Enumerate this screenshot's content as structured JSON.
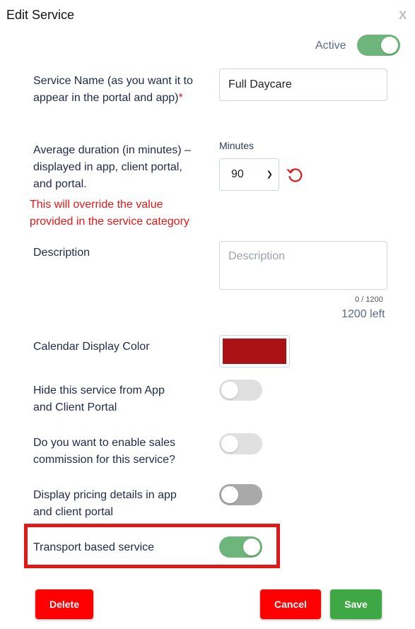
{
  "dialog": {
    "title": "Edit Service",
    "close_label": "X"
  },
  "active": {
    "label": "Active",
    "state": true
  },
  "service_name": {
    "label": "Service Name (as you want it to appear in the portal and app)",
    "required_mark": "*",
    "value": "Full Daycare"
  },
  "duration": {
    "label": "Average duration (in minutes) – displayed in app, client portal, and portal.",
    "unit_label": "Minutes",
    "selected": "90",
    "warning": "This will override the value provided in the service category",
    "reset_icon": "refresh-icon"
  },
  "description": {
    "label": "Description",
    "placeholder": "Description",
    "value": "",
    "counter": "0 / 1200",
    "remaining": "1200 left"
  },
  "calendar_color": {
    "label": "Calendar Display Color",
    "value": "#aa1215"
  },
  "hide_service": {
    "label": "Hide this service from App and Client Portal",
    "state": false
  },
  "sales_commission": {
    "label": "Do you want to enable sales commission for this service?",
    "state": false
  },
  "display_pricing": {
    "label": "Display pricing details in app and client portal",
    "state": false
  },
  "transport_based": {
    "label": "Transport based service",
    "state": true
  },
  "buttons": {
    "delete": "Delete",
    "cancel": "Cancel",
    "save": "Save"
  },
  "colors": {
    "toggle_on": "#6db57a",
    "danger": "#ff0000",
    "success": "#3ea845",
    "warning_text": "#e01818",
    "highlight": "#e01818"
  }
}
